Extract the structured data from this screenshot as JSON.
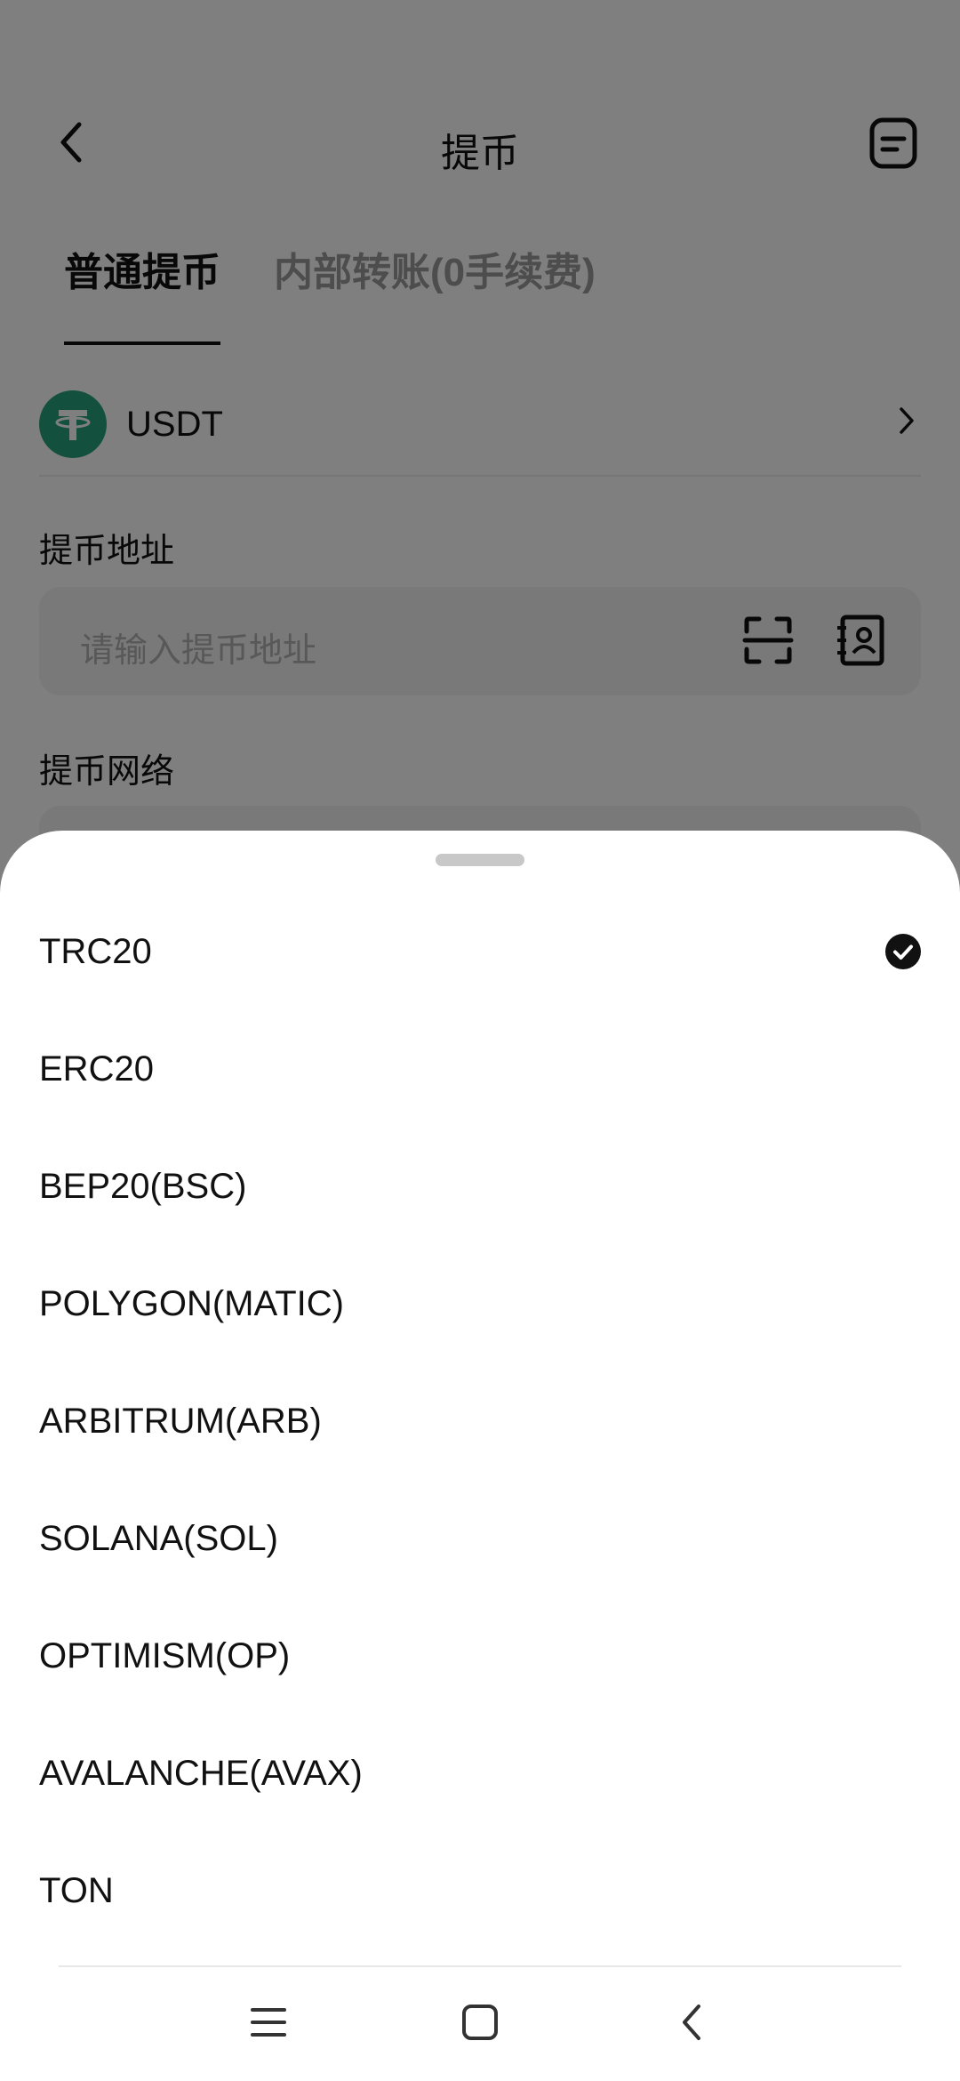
{
  "header": {
    "title": "提币"
  },
  "tabs": [
    {
      "label": "普通提币",
      "active": true
    },
    {
      "label": "内部转账(0手续费)",
      "active": false
    }
  ],
  "coin": {
    "name": "USDT",
    "logo_color": "#26a17b"
  },
  "address": {
    "label": "提币地址",
    "placeholder": "请输入提币地址"
  },
  "network": {
    "label": "提币网络"
  },
  "sheet": {
    "selected_index": 0,
    "networks": [
      {
        "label": "TRC20"
      },
      {
        "label": "ERC20"
      },
      {
        "label": "BEP20(BSC)"
      },
      {
        "label": "POLYGON(MATIC)"
      },
      {
        "label": "ARBITRUM(ARB)"
      },
      {
        "label": "SOLANA(SOL)"
      },
      {
        "label": "OPTIMISM(OP)"
      },
      {
        "label": "AVALANCHE(AVAX)"
      },
      {
        "label": "TON"
      }
    ]
  },
  "icons": {
    "back": "chevron-left-icon",
    "record": "document-icon",
    "scan": "scan-icon",
    "address_book": "address-book-icon",
    "check": "check-circle-icon",
    "nav_menu": "menu-icon",
    "nav_home": "home-square-icon",
    "nav_back": "back-arrow-icon"
  }
}
